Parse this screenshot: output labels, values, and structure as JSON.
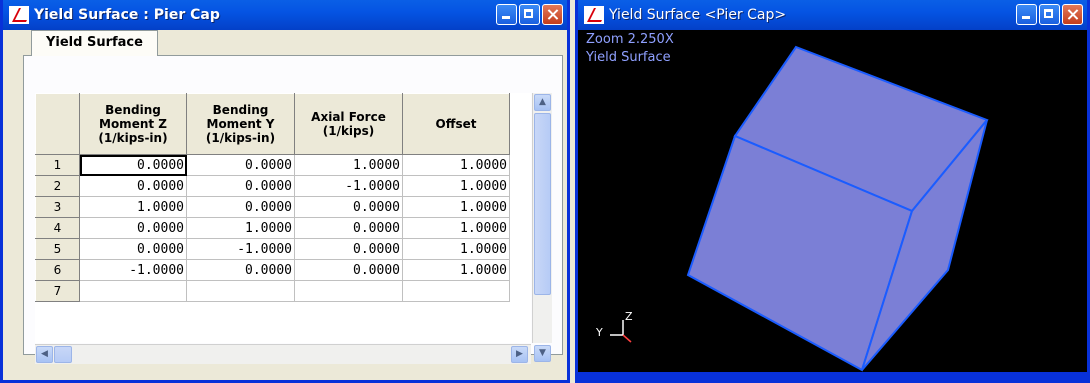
{
  "left_window": {
    "title": "Yield Surface : Pier Cap",
    "tab_label": "Yield Surface",
    "columns": [
      "Bending Moment Z (1/kips-in)",
      "Bending Moment Y (1/kips-in)",
      "Axial Force (1/kips)",
      "Offset"
    ],
    "column_lines": [
      [
        "Bending",
        "Moment Z",
        "(1/kips-in)"
      ],
      [
        "Bending",
        "Moment Y",
        "(1/kips-in)"
      ],
      [
        "Axial Force",
        "(1/kips)"
      ],
      [
        "Offset"
      ]
    ],
    "rows": [
      {
        "num": "1",
        "cells": [
          "0.0000",
          "0.0000",
          "1.0000",
          "1.0000"
        ]
      },
      {
        "num": "2",
        "cells": [
          "0.0000",
          "0.0000",
          "-1.0000",
          "1.0000"
        ]
      },
      {
        "num": "3",
        "cells": [
          "1.0000",
          "0.0000",
          "0.0000",
          "1.0000"
        ]
      },
      {
        "num": "4",
        "cells": [
          "0.0000",
          "1.0000",
          "0.0000",
          "1.0000"
        ]
      },
      {
        "num": "5",
        "cells": [
          "0.0000",
          "-1.0000",
          "0.0000",
          "1.0000"
        ]
      },
      {
        "num": "6",
        "cells": [
          "-1.0000",
          "0.0000",
          "0.0000",
          "1.0000"
        ]
      },
      {
        "num": "7",
        "cells": [
          "",
          "",
          "",
          ""
        ]
      }
    ]
  },
  "right_window": {
    "title": "Yield Surface <Pier Cap>",
    "zoom_text": "Zoom  2.250X",
    "view_label": "Yield Surface",
    "axes": [
      "Y",
      "Z"
    ]
  },
  "colors": {
    "titlebar": "#0554e3",
    "cube_fill": "#7b7fd6",
    "cube_edge": "#1a5cff",
    "overlay_text": "#8fa0ff"
  }
}
